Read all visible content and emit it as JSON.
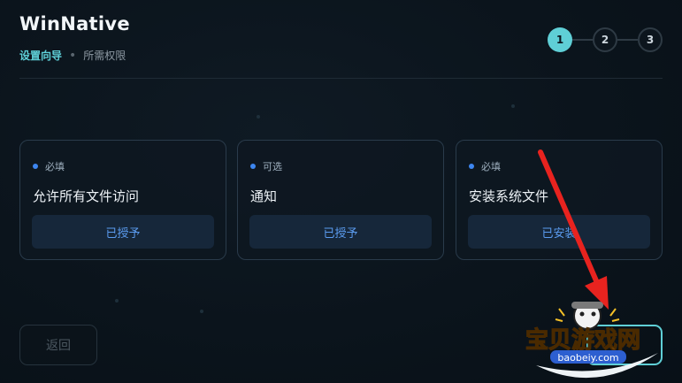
{
  "app": {
    "title": "WinNative",
    "breadcrumb_step": "设置向导",
    "breadcrumb_current": "所需权限"
  },
  "stepper": [
    "1",
    "2",
    "3"
  ],
  "cards": [
    {
      "badge": "必填",
      "title": "允许所有文件访问",
      "button": "已授予"
    },
    {
      "badge": "可选",
      "title": "通知",
      "button": "已授予"
    },
    {
      "badge": "必填",
      "title": "安装系统文件",
      "button": "已安装"
    }
  ],
  "footer": {
    "back": "返回"
  },
  "watermark": {
    "text": "宝贝游戏网",
    "url": "baobeiy.com"
  },
  "colors": {
    "accent": "#5fcfd6",
    "blue": "#3d86f0",
    "arrow": "#e8231f",
    "watermark": "#f5a623"
  }
}
